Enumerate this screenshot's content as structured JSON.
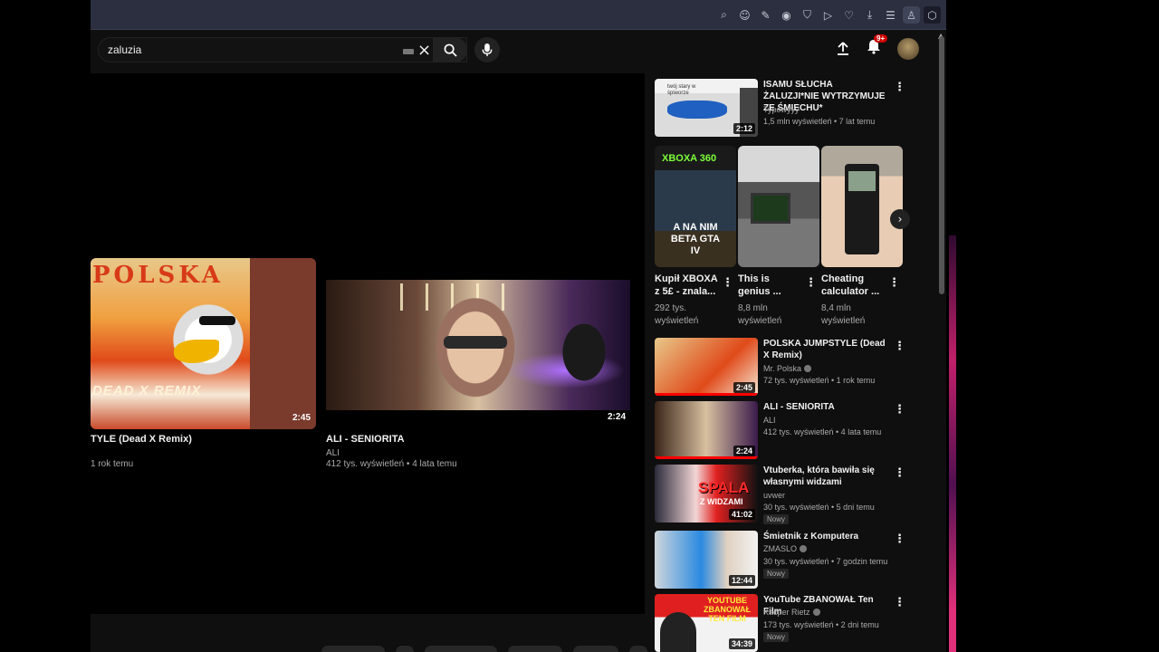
{
  "search": {
    "value": "zaluzia"
  },
  "header": {
    "notif_count": "9+"
  },
  "player": {
    "endcards": [
      {
        "title_visible": "TYLE (Dead X Remix)",
        "meta_visible": "1 rok temu",
        "duration": "2:45",
        "thumb_word": "POLSKA",
        "thumb_remix": "DEAD X REMIX"
      },
      {
        "title": "ALI - SENIORITA",
        "channel": "ALI",
        "meta": "412 tys. wyświetleń • 4 lata temu",
        "duration": "2:24"
      }
    ]
  },
  "sidebar": {
    "first": {
      "title": "ISAMU SŁUCHA ŻALUZJI*NIE WYTRZYMUJE ZE ŚMIECHU*",
      "channel": "Typowyyy",
      "meta": "1,5 mln wyświetleń • 7 lat temu",
      "duration": "2:12",
      "thumb_caption": "twój stary w śpiworze"
    },
    "shorts": [
      {
        "title": "Kupił XBOXA z 5£ - znala...",
        "views": "292 tys. wyświetleń",
        "thumb_top": "XBOXA 360",
        "thumb_bottom": "A NA NIM BETA GTA IV"
      },
      {
        "title": "This is genius  ...",
        "views": "8,8 mln wyświetleń"
      },
      {
        "title": "Cheating calculator ...",
        "views": "8,4 mln wyświetleń"
      }
    ],
    "videos": [
      {
        "title": "POLSKA JUMPSTYLE (Dead X Remix)",
        "channel": "Mr. Polska",
        "meta": "72 tys. wyświetleń • 1 rok temu",
        "duration": "2:45",
        "verified": true,
        "new": ""
      },
      {
        "title": "ALI - SENIORITA",
        "channel": "ALI",
        "meta": "412 tys. wyświetleń • 4 lata temu",
        "duration": "2:24",
        "verified": false,
        "new": ""
      },
      {
        "title": "Vtuberka, która bawiła się własnymi widzami",
        "channel": "uvwer",
        "meta": "30 tys. wyświetleń • 5 dni temu",
        "duration": "41:02",
        "verified": false,
        "new": "Nowy",
        "thumb_text": "SPALA",
        "thumb_sub": "Z WIDZAMI"
      },
      {
        "title": "Śmietnik z Komputera",
        "channel": "ZMASLO",
        "meta": "30 tys. wyświetleń • 7 godzin temu",
        "duration": "12:44",
        "verified": true,
        "new": "Nowy"
      },
      {
        "title": "YouTube ZBANOWAŁ Ten Film",
        "channel": "Kacper Rietz",
        "meta": "173 tys. wyświetleń • 2 dni temu",
        "duration": "34:39",
        "verified": true,
        "new": "Nowy",
        "thumb_text": "YOUTUBE ZBANOWAŁ TEN FILM"
      }
    ]
  },
  "colors": {
    "accent": "#ff0000",
    "bg": "#0f0f0f",
    "browser_bar": "#2b2f3f"
  }
}
